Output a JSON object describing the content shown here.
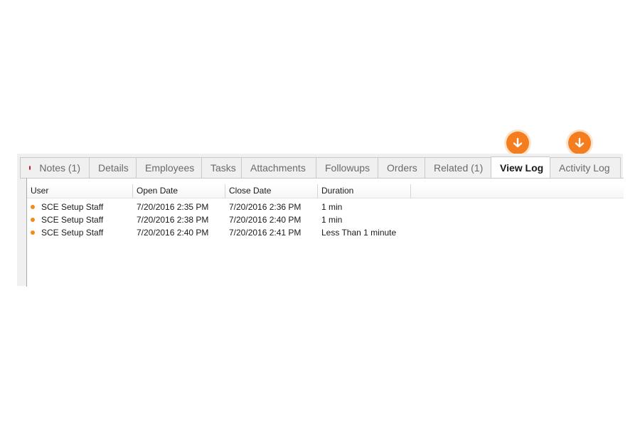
{
  "colors": {
    "accent_orange": "#f47d20",
    "unread_dot": "#d0102a",
    "status_dot": "#f08c1e"
  },
  "callouts": [
    {
      "icon": "arrow-down-icon",
      "target": "View Log"
    },
    {
      "icon": "arrow-down-icon",
      "target": "Activity Log"
    }
  ],
  "tabs": [
    {
      "label": "Notes (1)",
      "has_dot": true
    },
    {
      "label": "Details"
    },
    {
      "label": "Employees"
    },
    {
      "label": "Tasks"
    },
    {
      "label": "Attachments"
    },
    {
      "label": "Followups"
    },
    {
      "label": "Orders"
    },
    {
      "label": "Related (1)"
    },
    {
      "label": "View Log",
      "active": true
    },
    {
      "label": "Activity Log"
    }
  ],
  "log_table": {
    "columns": [
      "User",
      "Open Date",
      "Close Date",
      "Duration"
    ],
    "rows": [
      {
        "user": "SCE Setup Staff",
        "open": "7/20/2016 2:35 PM",
        "close": "7/20/2016 2:36 PM",
        "duration": "1 min"
      },
      {
        "user": "SCE Setup Staff",
        "open": "7/20/2016 2:38 PM",
        "close": "7/20/2016 2:40 PM",
        "duration": "1 min"
      },
      {
        "user": "SCE Setup Staff",
        "open": "7/20/2016 2:40 PM",
        "close": "7/20/2016 2:41 PM",
        "duration": "Less Than 1 minute"
      }
    ]
  }
}
